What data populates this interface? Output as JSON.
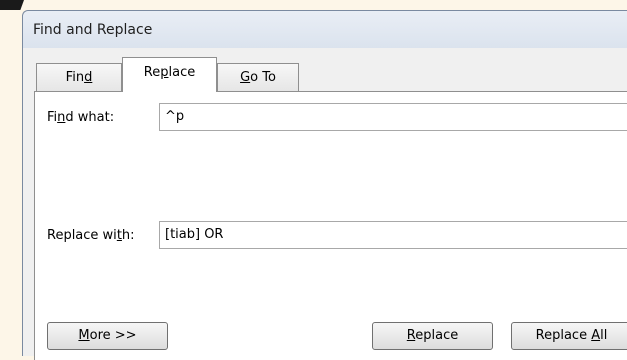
{
  "window": {
    "title": "Find and Replace"
  },
  "tabs": [
    {
      "pre": "Fin",
      "key": "d",
      "post": ""
    },
    {
      "pre": "Re",
      "key": "p",
      "post": "lace"
    },
    {
      "pre": "",
      "key": "G",
      "post": "o To"
    }
  ],
  "find": {
    "label_pre": "Fi",
    "label_key": "n",
    "label_post": "d what:",
    "value": "^p"
  },
  "replace": {
    "label_pre": "Replace wi",
    "label_key": "t",
    "label_post": "h:",
    "value": "[tiab] OR"
  },
  "buttons": {
    "more": {
      "pre": "",
      "key": "M",
      "post": "ore >>"
    },
    "replace": {
      "pre": "",
      "key": "R",
      "post": "eplace"
    },
    "replace_all": {
      "pre": "Replace ",
      "key": "A",
      "post": "ll"
    }
  }
}
